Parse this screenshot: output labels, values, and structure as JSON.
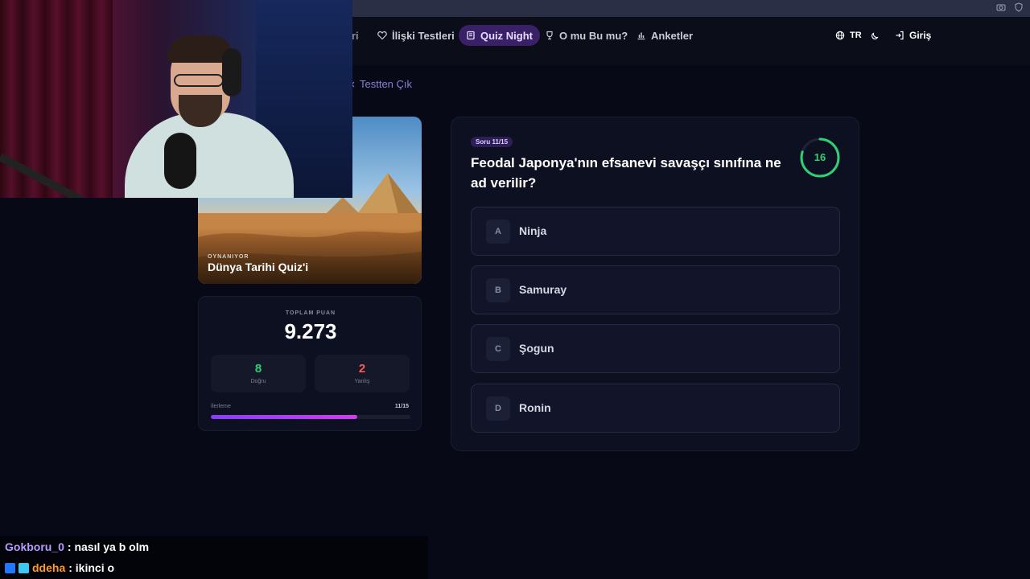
{
  "navbar": {
    "cut_item": "ri",
    "items": [
      {
        "label": "İlişki Testleri",
        "icon": "heart-icon"
      },
      {
        "label": "Quiz Night",
        "icon": "book-icon",
        "active": true
      },
      {
        "label": "O mu Bu mu?",
        "icon": "trophy-icon"
      },
      {
        "label": "Anketler",
        "icon": "bar-chart-icon"
      }
    ],
    "language": "TR",
    "login": "Giriş"
  },
  "exit": {
    "label": "Testten Çık"
  },
  "quiz_card": {
    "playing_label": "OYNANIYOR",
    "title": "Dünya Tarihi Quiz'i"
  },
  "score": {
    "label": "TOPLAM PUAN",
    "value": "9.273",
    "correct": {
      "value": "8",
      "label": "Doğru"
    },
    "wrong": {
      "value": "2",
      "label": "Yanlış"
    },
    "progress_label": "İlerleme",
    "progress_count": "11/15",
    "progress_fraction": 0.733
  },
  "question": {
    "badge": "Soru 11/15",
    "text": "Feodal Japonya'nın efsanevi savaşçı sınıfına ne ad verilir?",
    "timer": "16",
    "timer_fraction": 0.8,
    "answers": [
      {
        "letter": "A",
        "text": "Ninja"
      },
      {
        "letter": "B",
        "text": "Samuray"
      },
      {
        "letter": "C",
        "text": "Şogun"
      },
      {
        "letter": "D",
        "text": "Ronin"
      }
    ]
  },
  "chat": [
    {
      "user": "Gokboru_0",
      "message": ": nasıl ya b olm",
      "color": "#b79bff"
    },
    {
      "user": "ddeha",
      "message": ": ikinci o",
      "color": "#ff9a2a"
    }
  ],
  "colors": {
    "accent": "#8a3cff",
    "correct": "#2fd176",
    "wrong": "#ff5a5a",
    "background": "#070a16"
  }
}
